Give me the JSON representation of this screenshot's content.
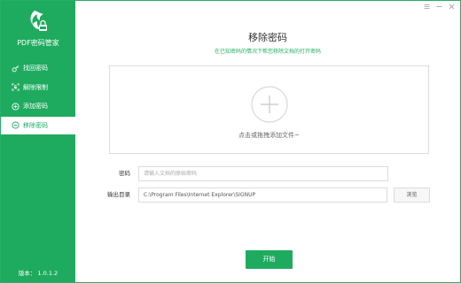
{
  "app": {
    "name": "PDF密码管家",
    "version": "版本： 1.0.1.2",
    "brand_color": "#1fab5f"
  },
  "window_controls": [
    {
      "icon": "menu-icon"
    },
    {
      "icon": "minimize-icon"
    },
    {
      "icon": "close-icon"
    }
  ],
  "sidebar": {
    "items": [
      {
        "label": "找回密码",
        "icon": "key-icon",
        "active": false
      },
      {
        "label": "解除限制",
        "icon": "unlock-scan-icon",
        "active": false
      },
      {
        "label": "添加密码",
        "icon": "add-circle-icon",
        "active": false
      },
      {
        "label": "移除密码",
        "icon": "remove-circle-icon",
        "active": true
      }
    ]
  },
  "main": {
    "title": "移除密码",
    "subtitle": "在已知密码的情况下帮您移除文档的打开密码",
    "dropzone_text": "点击或拖拽添加文件~",
    "password": {
      "label": "密码",
      "placeholder": "请输入文档的原始密码",
      "value": ""
    },
    "output": {
      "label": "输出目录",
      "value": "C:\\Program Files\\Internet Explorer\\SIGNUP"
    },
    "browse_label": "浏览",
    "start_label": "开始"
  }
}
